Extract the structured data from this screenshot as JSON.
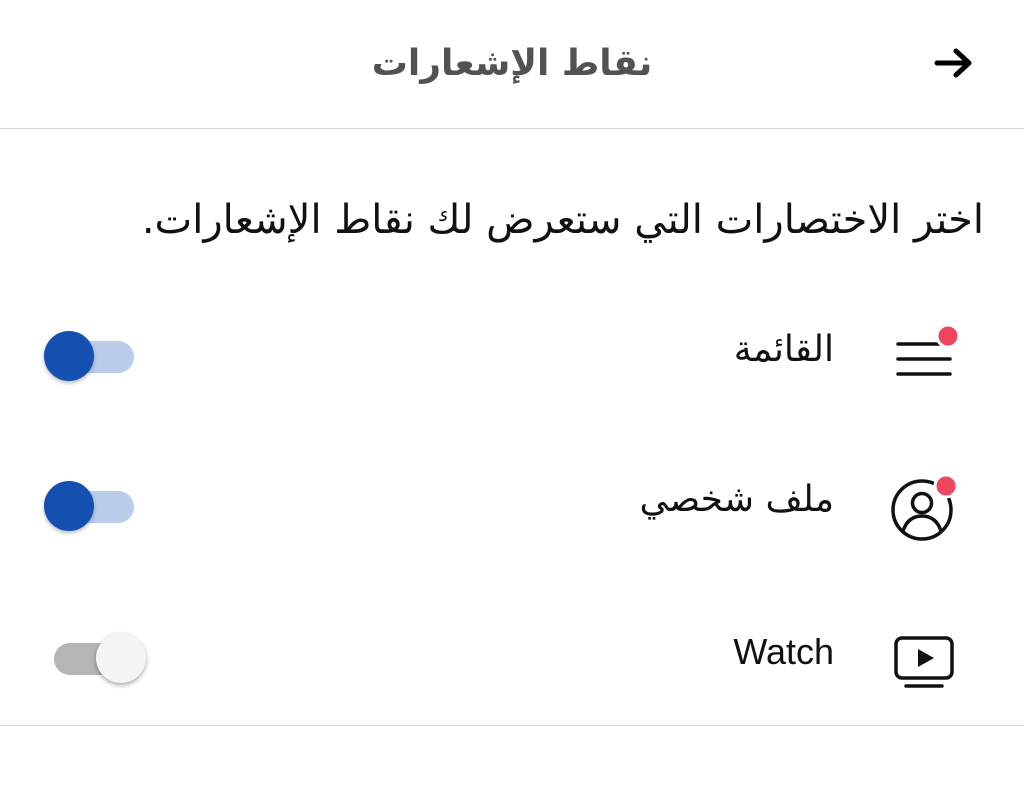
{
  "header": {
    "title": "نقاط الإشعارات",
    "back_icon": "arrow-right-icon"
  },
  "description": "اختر الاختصارات التي ستعرض لك نقاط الإشعارات.",
  "colors": {
    "accent": "#1350b0",
    "accent_track": "#b9cdeb",
    "badge": "#f0455f",
    "off_track": "#b5b5b5",
    "off_knob": "#f5f5f5"
  },
  "items": [
    {
      "label": "القائمة",
      "icon": "menu-icon",
      "has_badge": true,
      "enabled": true
    },
    {
      "label": "ملف شخصي",
      "icon": "profile-icon",
      "has_badge": true,
      "enabled": true
    },
    {
      "label": "Watch",
      "icon": "watch-icon",
      "has_badge": false,
      "enabled": false
    }
  ]
}
